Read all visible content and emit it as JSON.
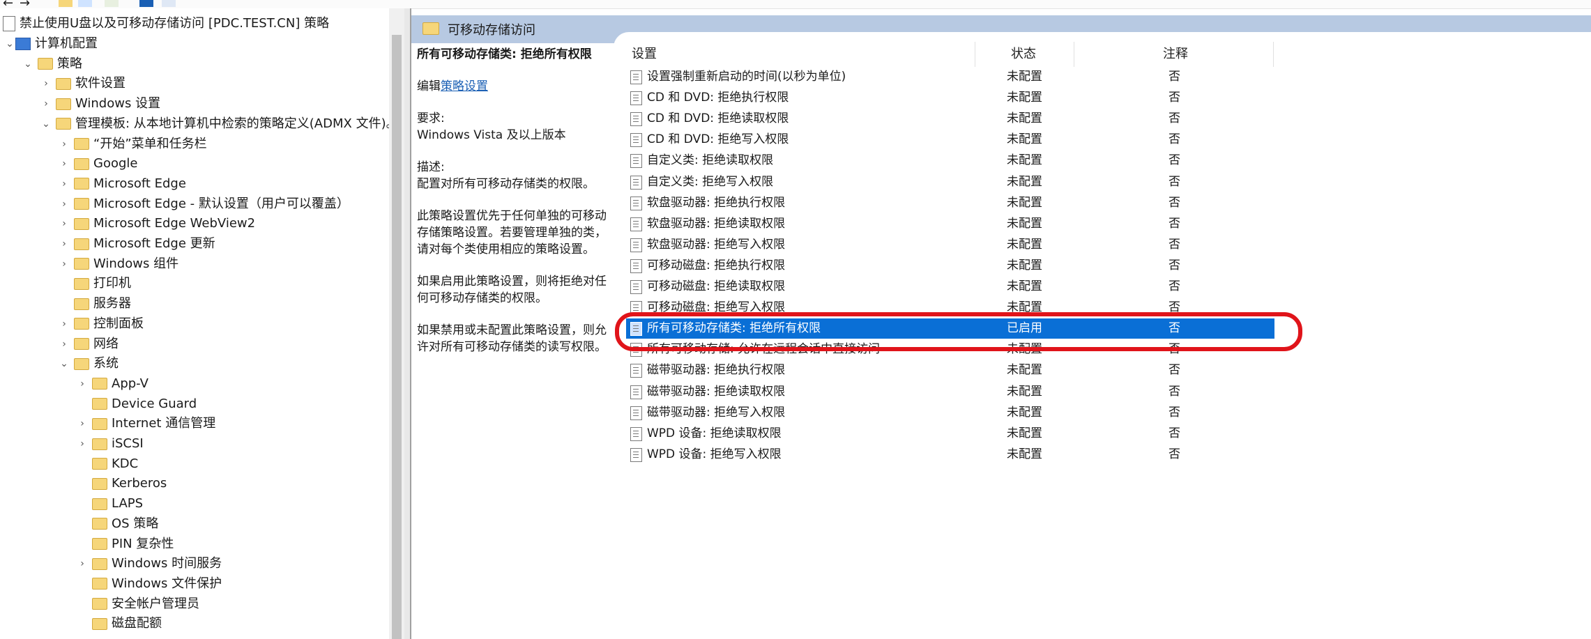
{
  "tree": {
    "root_label": "禁止使用U盘以及可移动存储访问 [PDC.TEST.CN] 策略",
    "items": [
      {
        "label": "计算机配置",
        "level": 0,
        "twisty": "expanded",
        "icon": "computer-icon"
      },
      {
        "label": "策略",
        "level": 1,
        "twisty": "expanded",
        "icon": "folder-icon"
      },
      {
        "label": "软件设置",
        "level": 2,
        "twisty": "collapsed",
        "icon": "folder-icon"
      },
      {
        "label": "Windows 设置",
        "level": 2,
        "twisty": "collapsed",
        "icon": "folder-icon"
      },
      {
        "label": "管理模板: 从本地计算机中检索的策略定义(ADMX 文件)。",
        "level": 2,
        "twisty": "expanded",
        "icon": "folder-icon"
      },
      {
        "label": "“开始”菜单和任务栏",
        "level": 3,
        "twisty": "collapsed",
        "icon": "folder-icon"
      },
      {
        "label": "Google",
        "level": 3,
        "twisty": "collapsed",
        "icon": "folder-icon"
      },
      {
        "label": "Microsoft Edge",
        "level": 3,
        "twisty": "collapsed",
        "icon": "folder-icon"
      },
      {
        "label": "Microsoft Edge - 默认设置（用户可以覆盖）",
        "level": 3,
        "twisty": "collapsed",
        "icon": "folder-icon"
      },
      {
        "label": "Microsoft Edge WebView2",
        "level": 3,
        "twisty": "collapsed",
        "icon": "folder-icon"
      },
      {
        "label": "Microsoft Edge 更新",
        "level": 3,
        "twisty": "collapsed",
        "icon": "folder-icon"
      },
      {
        "label": "Windows 组件",
        "level": 3,
        "twisty": "collapsed",
        "icon": "folder-icon"
      },
      {
        "label": "打印机",
        "level": 3,
        "twisty": "none",
        "icon": "folder-icon"
      },
      {
        "label": "服务器",
        "level": 3,
        "twisty": "none",
        "icon": "folder-icon"
      },
      {
        "label": "控制面板",
        "level": 3,
        "twisty": "collapsed",
        "icon": "folder-icon"
      },
      {
        "label": "网络",
        "level": 3,
        "twisty": "collapsed",
        "icon": "folder-icon"
      },
      {
        "label": "系统",
        "level": 3,
        "twisty": "expanded",
        "icon": "folder-icon"
      },
      {
        "label": "App-V",
        "level": 4,
        "twisty": "collapsed",
        "icon": "folder-icon"
      },
      {
        "label": "Device Guard",
        "level": 4,
        "twisty": "none",
        "icon": "folder-icon"
      },
      {
        "label": "Internet 通信管理",
        "level": 4,
        "twisty": "collapsed",
        "icon": "folder-icon"
      },
      {
        "label": "iSCSI",
        "level": 4,
        "twisty": "collapsed",
        "icon": "folder-icon"
      },
      {
        "label": "KDC",
        "level": 4,
        "twisty": "none",
        "icon": "folder-icon"
      },
      {
        "label": "Kerberos",
        "level": 4,
        "twisty": "none",
        "icon": "folder-icon"
      },
      {
        "label": "LAPS",
        "level": 4,
        "twisty": "none",
        "icon": "folder-icon"
      },
      {
        "label": "OS 策略",
        "level": 4,
        "twisty": "none",
        "icon": "folder-icon"
      },
      {
        "label": "PIN 复杂性",
        "level": 4,
        "twisty": "none",
        "icon": "folder-icon"
      },
      {
        "label": "Windows 时间服务",
        "level": 4,
        "twisty": "collapsed",
        "icon": "folder-icon"
      },
      {
        "label": "Windows 文件保护",
        "level": 4,
        "twisty": "none",
        "icon": "folder-icon"
      },
      {
        "label": "安全帐户管理员",
        "level": 4,
        "twisty": "none",
        "icon": "folder-icon"
      },
      {
        "label": "磁盘配额",
        "level": 4,
        "twisty": "none",
        "icon": "folder-icon"
      }
    ]
  },
  "header": {
    "title": "可移动存储访问",
    "icon": "folder-icon"
  },
  "description": {
    "policy_title": "所有可移动存储类: 拒绝所有权限",
    "edit_prefix": "编辑",
    "edit_link": "策略设置",
    "requirements_label": "要求:",
    "requirements": "Windows Vista 及以上版本",
    "desc_label": "描述:",
    "desc": "配置对所有可移动存储类的权限。",
    "para1": "此策略设置优先于任何单独的可移动存储策略设置。若要管理单独的类，请对每个类使用相应的策略设置。",
    "para2": "如果启用此策略设置，则将拒绝对任何可移动存储类的权限。",
    "para3": "如果禁用或未配置此策略设置，则允许对所有可移动存储类的读写权限。"
  },
  "table": {
    "columns": {
      "setting": "设置",
      "state": "状态",
      "note": "注释"
    },
    "rows": [
      {
        "name": "设置强制重新启动的时间(以秒为单位)",
        "state": "未配置",
        "note": "否"
      },
      {
        "name": "CD 和 DVD: 拒绝执行权限",
        "state": "未配置",
        "note": "否"
      },
      {
        "name": "CD 和 DVD: 拒绝读取权限",
        "state": "未配置",
        "note": "否"
      },
      {
        "name": "CD 和 DVD: 拒绝写入权限",
        "state": "未配置",
        "note": "否"
      },
      {
        "name": "自定义类: 拒绝读取权限",
        "state": "未配置",
        "note": "否"
      },
      {
        "name": "自定义类: 拒绝写入权限",
        "state": "未配置",
        "note": "否"
      },
      {
        "name": "软盘驱动器: 拒绝执行权限",
        "state": "未配置",
        "note": "否"
      },
      {
        "name": "软盘驱动器: 拒绝读取权限",
        "state": "未配置",
        "note": "否"
      },
      {
        "name": "软盘驱动器: 拒绝写入权限",
        "state": "未配置",
        "note": "否"
      },
      {
        "name": "可移动磁盘: 拒绝执行权限",
        "state": "未配置",
        "note": "否"
      },
      {
        "name": "可移动磁盘: 拒绝读取权限",
        "state": "未配置",
        "note": "否"
      },
      {
        "name": "可移动磁盘: 拒绝写入权限",
        "state": "未配置",
        "note": "否"
      },
      {
        "name": "所有可移动存储类: 拒绝所有权限",
        "state": "已启用",
        "note": "否",
        "selected": true
      },
      {
        "name": "所有可移动存储: 允许在远程会话中直接访问",
        "state": "未配置",
        "note": "否"
      },
      {
        "name": "磁带驱动器: 拒绝执行权限",
        "state": "未配置",
        "note": "否"
      },
      {
        "name": "磁带驱动器: 拒绝读取权限",
        "state": "未配置",
        "note": "否"
      },
      {
        "name": "磁带驱动器: 拒绝写入权限",
        "state": "未配置",
        "note": "否"
      },
      {
        "name": "WPD 设备: 拒绝读取权限",
        "state": "未配置",
        "note": "否"
      },
      {
        "name": "WPD 设备: 拒绝写入权限",
        "state": "未配置",
        "note": "否"
      }
    ]
  },
  "colors": {
    "selection": "#0a6fd6",
    "highlight_ring": "#e0141a",
    "header_bg": "#b7c9e2",
    "link": "#1a5fb4"
  }
}
